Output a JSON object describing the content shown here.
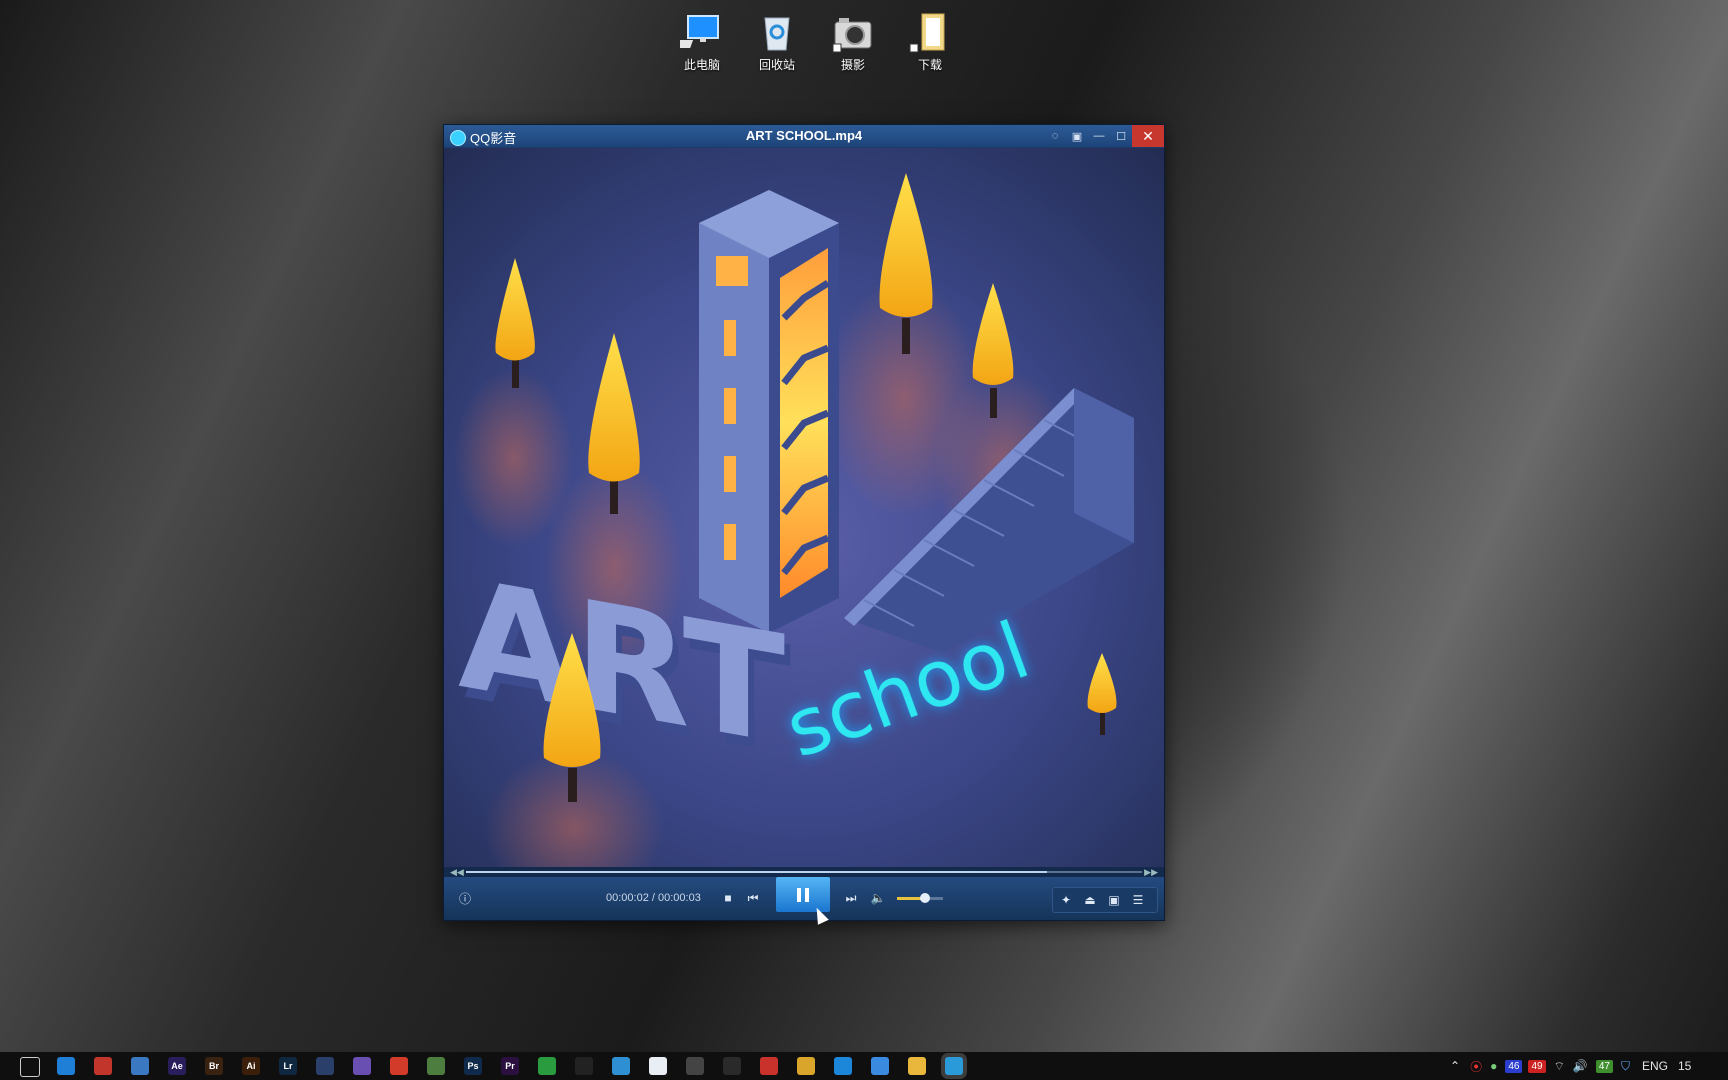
{
  "desktop": {
    "icons": [
      {
        "label": "此电脑",
        "icon": "computer-icon"
      },
      {
        "label": "回收站",
        "icon": "recycle-bin-icon"
      },
      {
        "label": "摄影",
        "icon": "camera-icon"
      },
      {
        "label": "下载",
        "icon": "folder-icon"
      }
    ]
  },
  "player": {
    "app_name": "QQ影音",
    "title": "ART SCHOOL.mp4",
    "time_display": "00:00:02 / 00:00:03",
    "progress": 0.86,
    "volume": 0.6,
    "video": {
      "headline_3d": "ART",
      "neon_text": "school"
    }
  },
  "taskbar": {
    "apps": [
      {
        "name": "task-view-icon",
        "label": "",
        "color": "#0f0f10"
      },
      {
        "name": "edge-icon",
        "label": "",
        "color": "#1f7fd6"
      },
      {
        "name": "app-red-icon",
        "label": "",
        "color": "#c1352b"
      },
      {
        "name": "app-blue-icon",
        "label": "",
        "color": "#3b78c2"
      },
      {
        "name": "after-effects-icon",
        "label": "Ae",
        "color": "#2a1d5c"
      },
      {
        "name": "bridge-icon",
        "label": "Br",
        "color": "#3a2210"
      },
      {
        "name": "illustrator-icon",
        "label": "Ai",
        "color": "#3c1f0a"
      },
      {
        "name": "lightroom-icon",
        "label": "Lr",
        "color": "#10283f"
      },
      {
        "name": "c4d-icon",
        "label": "",
        "color": "#2a3f6a"
      },
      {
        "name": "app-purple-icon",
        "label": "",
        "color": "#6a4fb3"
      },
      {
        "name": "recorder-icon",
        "label": "",
        "color": "#d23a2a"
      },
      {
        "name": "app-green-icon",
        "label": "",
        "color": "#4d7d3f"
      },
      {
        "name": "photoshop-icon",
        "label": "Ps",
        "color": "#0f2a4a"
      },
      {
        "name": "premiere-icon",
        "label": "Pr",
        "color": "#2a0f3f"
      },
      {
        "name": "wechat-icon",
        "label": "",
        "color": "#2b9b3f"
      },
      {
        "name": "qq-icon",
        "label": "",
        "color": "#222"
      },
      {
        "name": "app-cloud-icon",
        "label": "",
        "color": "#2f8fd3"
      },
      {
        "name": "app-baidu-icon",
        "label": "",
        "color": "#e9eef5"
      },
      {
        "name": "calculator-icon",
        "label": "",
        "color": "#444"
      },
      {
        "name": "app-colorful-icon",
        "label": "",
        "color": "#2a2a2a"
      },
      {
        "name": "app-red2-icon",
        "label": "",
        "color": "#c8322b"
      },
      {
        "name": "chrome-icon",
        "label": "",
        "color": "#d9a62b"
      },
      {
        "name": "app-thunder-icon",
        "label": "",
        "color": "#1c87d9"
      },
      {
        "name": "app-blue-circle-icon",
        "label": "",
        "color": "#3a8be0"
      },
      {
        "name": "explorer-icon",
        "label": "",
        "color": "#e8b73c"
      },
      {
        "name": "qqplayer-icon",
        "label": "",
        "color": "#2a9bd8"
      }
    ],
    "tray": {
      "badge1": "46",
      "badge2": "49",
      "badge3": "47",
      "lang": "ENG",
      "clock": "15"
    }
  }
}
